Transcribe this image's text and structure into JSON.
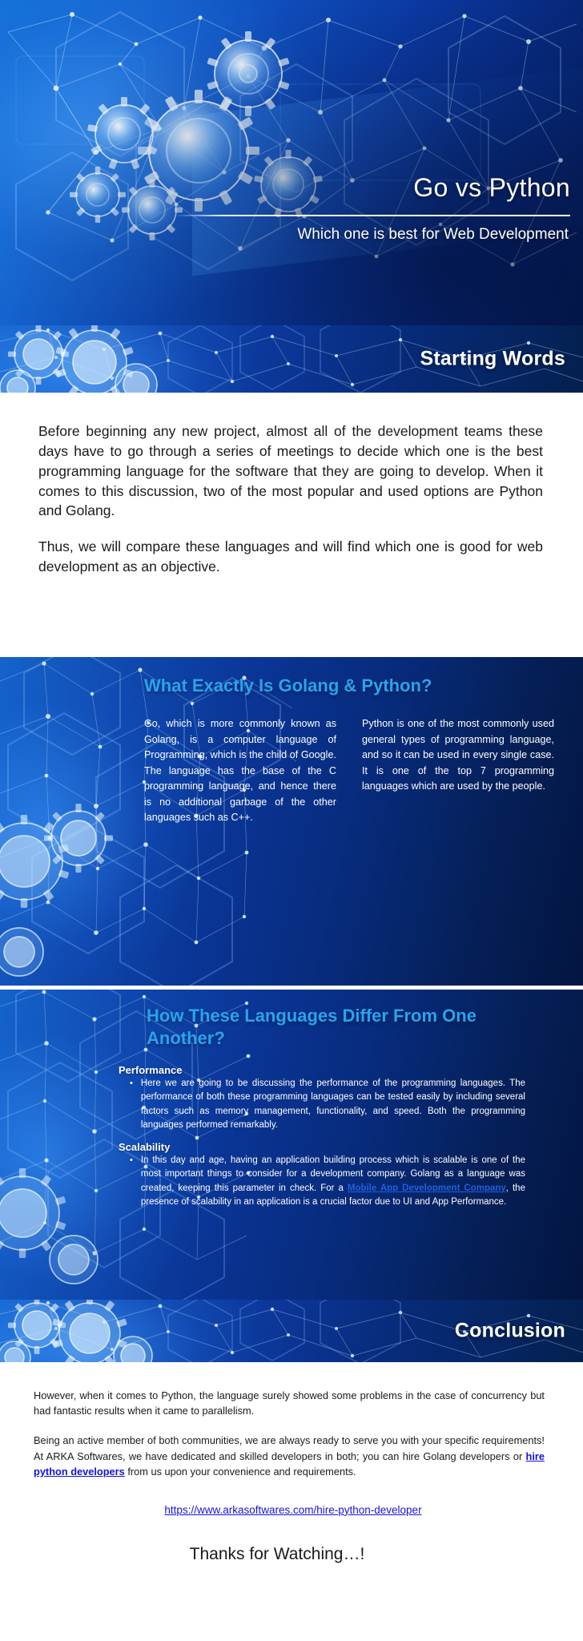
{
  "hero": {
    "title": "Go vs Python",
    "subtitle": "Which one is best for Web Development"
  },
  "sections": {
    "starting_words": {
      "banner_title": "Starting Words",
      "paragraphs": [
        "Before beginning any new project, almost all of the development teams these days have to go through a series of meetings to decide which one is the best programming language for the software that they are going to develop. When it comes to this discussion, two of the most popular and used options are Python and Golang.",
        "Thus, we will compare these languages and will find which one is good for web development as an objective."
      ]
    },
    "what_exactly": {
      "heading": "What Exactly Is Golang & Python?",
      "column_left": "Go, which is more commonly known as Golang, is a computer language of Programming, which is the child of Google. The language has the base of the C programming language, and hence there is no additional garbage of the other languages such as C++.",
      "column_right": "Python is one of the most commonly used general types of programming language, and so it can be used in every single case. It is one of the top 7 programming languages which are used by the people."
    },
    "how_differ": {
      "heading": "How These Languages Differ From One Another?",
      "items": [
        {
          "subhead": "Performance",
          "bullet_marker": "•",
          "text": "Here we are going to be discussing the performance of the programming languages. The performance of both these programming languages can be tested easily by including several factors such as memory management, functionality, and speed. Both the programming languages performed remarkably."
        },
        {
          "subhead": "Scalability",
          "bullet_marker": "•",
          "text_before_link": "In this day and age, having an application building process which is scalable is one of the most important things to consider for a development company. Golang as a language was created, keeping this parameter in check. For a ",
          "link_text": "Mobile App Development Company",
          "text_after_link": ", the presence of scalability in an application is a crucial factor due to UI and App Performance."
        }
      ]
    },
    "conclusion": {
      "banner_title": "Conclusion",
      "paragraph_1": "However, when it comes to Python, the language surely showed some problems in the case of concurrency but had fantastic results when it came to parallelism.",
      "paragraph_2_before_link": "Being an active member of both communities, we are always ready to serve you with your specific requirements! At ARKA Softwares, we have dedicated and skilled developers in both; you can hire Golang developers or ",
      "paragraph_2_link": "hire python developers",
      "paragraph_2_after_link": " from us upon your convenience and requirements.",
      "url": "https://www.arkasoftwares.com/hire-python-developer",
      "thanks": "Thanks for Watching…!"
    }
  },
  "colors": {
    "accent_cyan": "#28a4f0",
    "link_blue": "#1414d8",
    "inline_link_blue": "#1f5fe0",
    "deep_blue": "#031541",
    "bright_blue": "#1464cb"
  }
}
